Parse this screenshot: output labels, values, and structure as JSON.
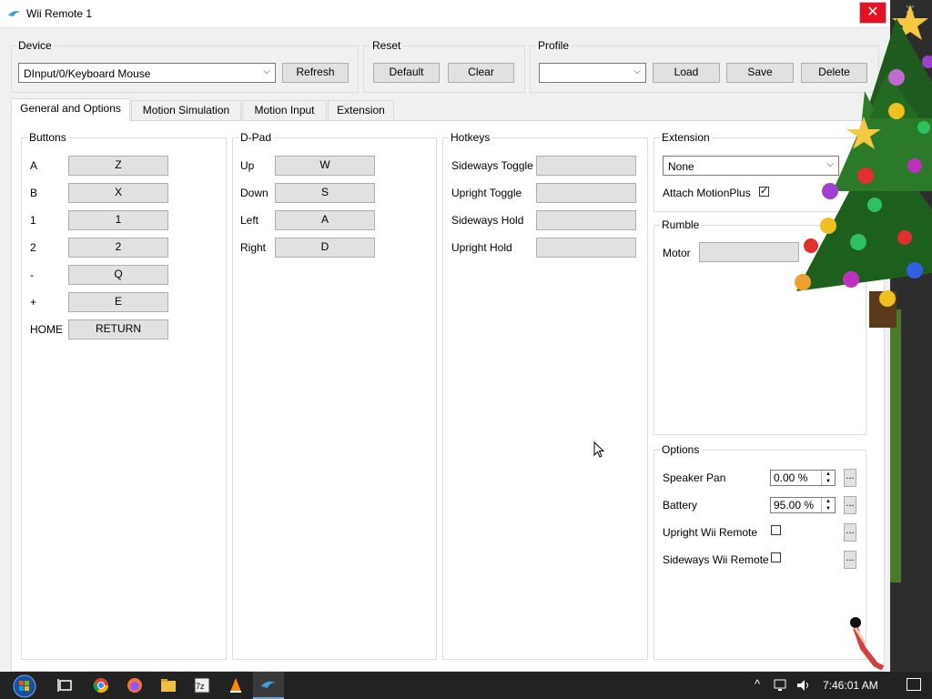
{
  "window": {
    "title": "Wii Remote 1"
  },
  "device": {
    "label": "Device",
    "selected": "DInput/0/Keyboard Mouse",
    "refresh_label": "Refresh"
  },
  "reset": {
    "label": "Reset",
    "default_label": "Default",
    "clear_label": "Clear"
  },
  "profile": {
    "label": "Profile",
    "selected": "",
    "load_label": "Load",
    "save_label": "Save",
    "delete_label": "Delete"
  },
  "tabs": [
    {
      "label": "General and Options",
      "active": true
    },
    {
      "label": "Motion Simulation",
      "active": false
    },
    {
      "label": "Motion Input",
      "active": false
    },
    {
      "label": "Extension",
      "active": false
    }
  ],
  "buttons_group": {
    "label": "Buttons",
    "rows": [
      {
        "name": "A",
        "key": "Z"
      },
      {
        "name": "B",
        "key": "X"
      },
      {
        "name": "1",
        "key": "1"
      },
      {
        "name": "2",
        "key": "2"
      },
      {
        "name": "-",
        "key": "Q"
      },
      {
        "name": "+",
        "key": "E"
      },
      {
        "name": "HOME",
        "key": "RETURN"
      }
    ]
  },
  "dpad_group": {
    "label": "D-Pad",
    "rows": [
      {
        "name": "Up",
        "key": "W"
      },
      {
        "name": "Down",
        "key": "S"
      },
      {
        "name": "Left",
        "key": "A"
      },
      {
        "name": "Right",
        "key": "D"
      }
    ]
  },
  "hotkeys_group": {
    "label": "Hotkeys",
    "rows": [
      {
        "name": "Sideways Toggle",
        "key": ""
      },
      {
        "name": "Upright Toggle",
        "key": ""
      },
      {
        "name": "Sideways Hold",
        "key": ""
      },
      {
        "name": "Upright Hold",
        "key": ""
      }
    ]
  },
  "extension_group": {
    "label": "Extension",
    "selected": "None",
    "attach_motionplus_label": "Attach MotionPlus",
    "attach_motionplus_checked": true
  },
  "rumble_group": {
    "label": "Rumble",
    "motor_label": "Motor",
    "motor_value": ""
  },
  "options_group": {
    "label": "Options",
    "speaker_pan_label": "Speaker Pan",
    "speaker_pan_value": "0.00 %",
    "battery_label": "Battery",
    "battery_value": "95.00 %",
    "upright_label": "Upright Wii Remote",
    "upright_checked": false,
    "sideways_label": "Sideways Wii Remote",
    "sideways_checked": false,
    "dots": "..."
  },
  "taskbar": {
    "clock": "7:46:01 AM"
  },
  "colors": {
    "close_red": "#e81123",
    "taskbar": "#222222",
    "window_bg": "#f0f0f0"
  }
}
